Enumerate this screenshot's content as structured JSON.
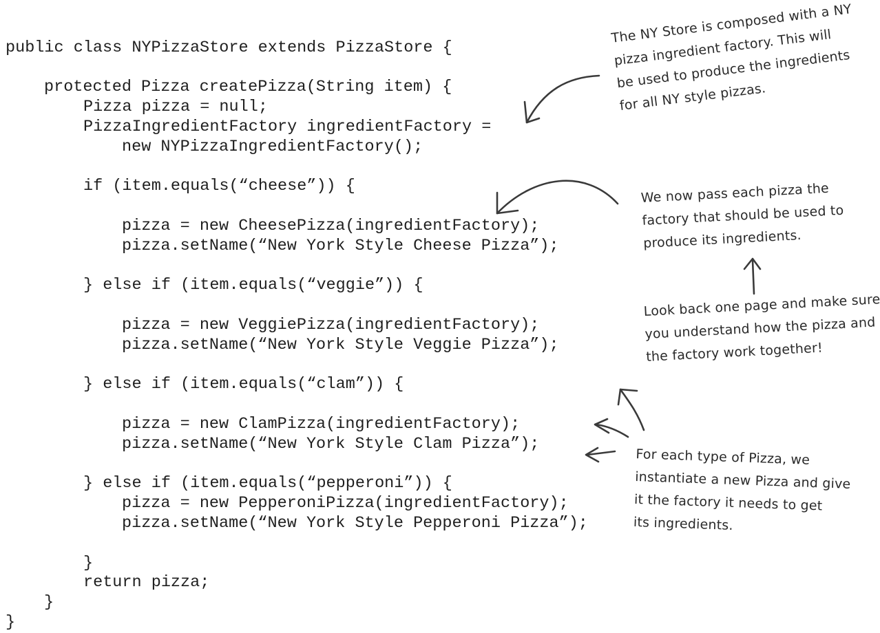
{
  "code": {
    "lines": [
      "public class NYPizzaStore extends PizzaStore {",
      "protected Pizza createPizza(String item) {",
      "Pizza pizza = null;",
      "PizzaIngredientFactory ingredientFactory =",
      "new NYPizzaIngredientFactory();",
      "if (item.equals(“cheese”)) {",
      "pizza = new CheesePizza(ingredientFactory);",
      "pizza.setName(“New York Style Cheese Pizza”);",
      "} else if (item.equals(“veggie”)) {",
      "pizza = new VeggiePizza(ingredientFactory);",
      "pizza.setName(“New York Style Veggie Pizza”);",
      "} else if (item.equals(“clam”)) {",
      "pizza = new ClamPizza(ingredientFactory);",
      "pizza.setName(“New York Style Clam Pizza”);",
      "} else if (item.equals(“pepperoni”)) {",
      "pizza = new PepperoniPizza(ingredientFactory);",
      "pizza.setName(“New York Style Pepperoni Pizza”);",
      "}",
      "return pizza;",
      "}",
      "}"
    ]
  },
  "annotations": {
    "composition_note": {
      "lines": [
        "The NY Store is composed with a NY",
        "pizza ingredient factory.  This will",
        "be used to produce the ingredients",
        "for all NY style pizzas."
      ]
    },
    "pass_factory_note": {
      "lines": [
        "We now pass each pizza the",
        "factory that should be used to",
        "produce its ingredients."
      ]
    },
    "look_back_note": {
      "lines": [
        "Look back one page and make sure",
        "you understand how the pizza and",
        "the factory work together!"
      ]
    },
    "each_type_note": {
      "lines": [
        "For each type of Pizza, we",
        "instantiate a new Pizza and give",
        "it the factory it needs to get",
        "its ingredients."
      ]
    }
  }
}
